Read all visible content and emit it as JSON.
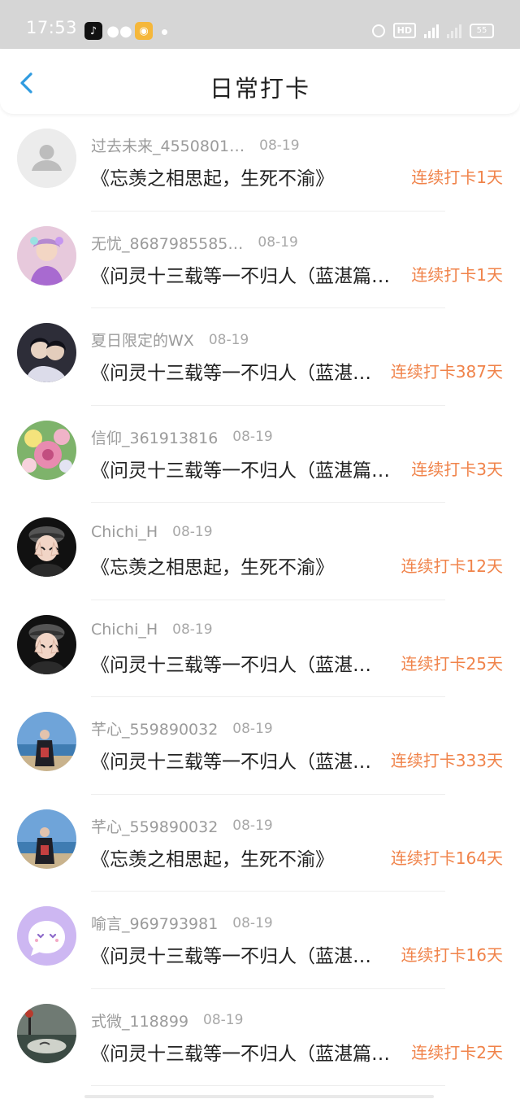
{
  "status_bar": {
    "time": "17:53",
    "battery": "55",
    "apps": [
      "tiktok-icon",
      "wechat-icon",
      "weibo-icon"
    ]
  },
  "header": {
    "title": "日常打卡"
  },
  "colors": {
    "accent": "#f0834a",
    "back": "#2f9be0",
    "title": "#222222",
    "meta": "#9b9b9b"
  },
  "entries": [
    {
      "username": "过去未来_4550801…",
      "date": "08-19",
      "title": "《忘羡之相思起，生死不渝》",
      "streak": "连续打卡1天",
      "avatar": "default-avatar"
    },
    {
      "username": "无忧_8687985585…",
      "date": "08-19",
      "title": "《问灵十三载等一不归人（蓝湛篇…",
      "streak": "连续打卡1天",
      "avatar": "girl-costume-avatar"
    },
    {
      "username": "夏日限定的WX",
      "date": "08-19",
      "title": "《问灵十三载等一不归人（蓝湛…",
      "streak": "连续打卡387天",
      "avatar": "couple-avatar"
    },
    {
      "username": "信仰_361913816",
      "date": "08-19",
      "title": "《问灵十三载等一不归人（蓝湛篇…",
      "streak": "连续打卡3天",
      "avatar": "flower-avatar"
    },
    {
      "username": "Chichi_H",
      "date": "08-19",
      "title": "《忘羡之相思起，生死不渝》",
      "streak": "连续打卡12天",
      "avatar": "cartoon-girl-avatar"
    },
    {
      "username": "Chichi_H",
      "date": "08-19",
      "title": "《问灵十三载等一不归人（蓝湛…",
      "streak": "连续打卡25天",
      "avatar": "cartoon-girl-avatar"
    },
    {
      "username": "芊心_559890032",
      "date": "08-19",
      "title": "《问灵十三载等一不归人（蓝湛…",
      "streak": "连续打卡333天",
      "avatar": "seaside-person-avatar"
    },
    {
      "username": "芊心_559890032",
      "date": "08-19",
      "title": "《忘羡之相思起，生死不渝》",
      "streak": "连续打卡164天",
      "avatar": "seaside-person-avatar"
    },
    {
      "username": "喻言_969793981",
      "date": "08-19",
      "title": "《问灵十三载等一不归人（蓝湛…",
      "streak": "连续打卡16天",
      "avatar": "purple-chat-avatar"
    },
    {
      "username": "式微_118899",
      "date": "08-19",
      "title": "《问灵十三载等一不归人（蓝湛篇…",
      "streak": "连续打卡2天",
      "avatar": "ink-scenery-avatar"
    }
  ]
}
